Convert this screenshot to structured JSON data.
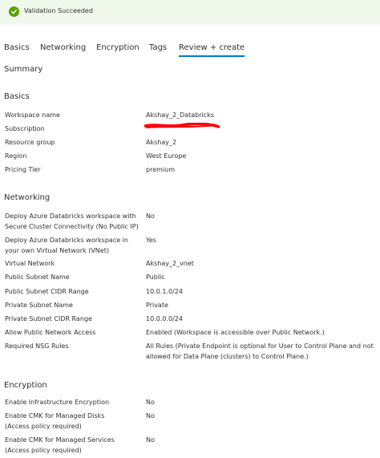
{
  "banner": {
    "icon": "check-circle-icon",
    "text": "Validation Succeeded",
    "color": "#57a300"
  },
  "tabs": [
    "Basics",
    "Networking",
    "Encryption",
    "Tags",
    "Review + create"
  ],
  "active_tab": "Review + create",
  "accent_color": "#0078d4",
  "summary_title": "Summary",
  "basics": {
    "title": "Basics",
    "rows": [
      {
        "label": "Workspace name",
        "value": "Akshay_2_Databricks"
      },
      {
        "label": "Subscription",
        "value": ""
      },
      {
        "label": "Resource group",
        "value": "Akshay_2"
      },
      {
        "label": "Region",
        "value": "West Europe"
      },
      {
        "label": "Pricing Tier",
        "value": "premium"
      }
    ]
  },
  "networking": {
    "title": "Networking",
    "rows": [
      {
        "label": [
          "Deploy Azure Databricks workspace with",
          "Secure Cluster Connectivity (No Public IP)"
        ],
        "value": [
          "No"
        ]
      },
      {
        "label": [
          "Deploy Azure Databricks workspace in",
          "your own Virtual Network (VNet)"
        ],
        "value": [
          "Yes"
        ]
      },
      {
        "label": [
          "Virtual Network"
        ],
        "value": [
          "Akshay_2_vnet"
        ]
      },
      {
        "label": [
          "Public Subnet Name"
        ],
        "value": [
          "Public"
        ]
      },
      {
        "label": [
          "Public Subnet CIDR Range"
        ],
        "value": [
          "10.0.1.0/24"
        ]
      },
      {
        "label": [
          "Private Subnet Name"
        ],
        "value": [
          "Private"
        ]
      },
      {
        "label": [
          "Private Subnet CIDR Range"
        ],
        "value": [
          "10.0.0.0/24"
        ]
      },
      {
        "label": [
          "Allow Public Network Access"
        ],
        "value": [
          "Enabled (Workspace is accessible over Public Network.)"
        ]
      },
      {
        "label": [
          "Required NSG Rules"
        ],
        "value": [
          "All Rules (Private Endpoint is optional for User to Control Plane and not",
          "allowed for Data Plane (clusters) to Control Plane.)"
        ]
      }
    ]
  },
  "encryption": {
    "title": "Encryption",
    "rows": [
      {
        "label": [
          "Enable Infrastructure Encryption"
        ],
        "value": "No"
      },
      {
        "label": [
          "Enable CMK for Managed Disks",
          "(Access policy required)"
        ],
        "value": "No"
      },
      {
        "label": [
          "Enable CMK for Managed Services",
          "(Access policy required)"
        ],
        "value": "No"
      }
    ]
  }
}
